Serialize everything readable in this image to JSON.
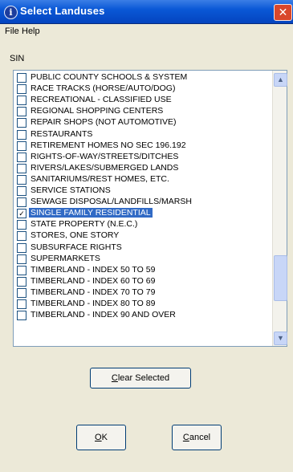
{
  "window": {
    "title": "Select Landuses",
    "close_glyph": "✕",
    "title_icon_glyph": "i"
  },
  "menu": [
    {
      "label": "File"
    },
    {
      "label": "Help"
    }
  ],
  "section_label": "SIN",
  "list": {
    "items": [
      {
        "label": "PUBLIC COUNTY SCHOOLS & SYSTEM",
        "checked": false,
        "selected": false
      },
      {
        "label": "RACE TRACKS (HORSE/AUTO/DOG)",
        "checked": false,
        "selected": false
      },
      {
        "label": "RECREATIONAL - CLASSIFIED USE",
        "checked": false,
        "selected": false
      },
      {
        "label": "REGIONAL SHOPPING CENTERS",
        "checked": false,
        "selected": false
      },
      {
        "label": "REPAIR SHOPS (NOT AUTOMOTIVE)",
        "checked": false,
        "selected": false
      },
      {
        "label": "RESTAURANTS",
        "checked": false,
        "selected": false
      },
      {
        "label": "RETIREMENT HOMES NO SEC 196.192",
        "checked": false,
        "selected": false
      },
      {
        "label": "RIGHTS-OF-WAY/STREETS/DITCHES",
        "checked": false,
        "selected": false
      },
      {
        "label": "RIVERS/LAKES/SUBMERGED LANDS",
        "checked": false,
        "selected": false
      },
      {
        "label": "SANITARIUMS/REST HOMES, ETC.",
        "checked": false,
        "selected": false
      },
      {
        "label": "SERVICE STATIONS",
        "checked": false,
        "selected": false
      },
      {
        "label": "SEWAGE DISPOSAL/LANDFILLS/MARSH",
        "checked": false,
        "selected": false
      },
      {
        "label": "SINGLE FAMILY RESIDENTIAL",
        "checked": true,
        "selected": true
      },
      {
        "label": "STATE PROPERTY (N.E.C.)",
        "checked": false,
        "selected": false
      },
      {
        "label": "STORES, ONE STORY",
        "checked": false,
        "selected": false
      },
      {
        "label": "SUBSURFACE RIGHTS",
        "checked": false,
        "selected": false
      },
      {
        "label": "SUPERMARKETS",
        "checked": false,
        "selected": false
      },
      {
        "label": "TIMBERLAND - INDEX 50 TO 59",
        "checked": false,
        "selected": false
      },
      {
        "label": "TIMBERLAND - INDEX 60 TO 69",
        "checked": false,
        "selected": false
      },
      {
        "label": "TIMBERLAND - INDEX 70 TO 79",
        "checked": false,
        "selected": false
      },
      {
        "label": "TIMBERLAND - INDEX 80 TO 89",
        "checked": false,
        "selected": false
      },
      {
        "label": "TIMBERLAND - INDEX 90 AND OVER",
        "checked": false,
        "selected": false
      }
    ],
    "check_glyph": "✓",
    "scroll_up_glyph": "▲",
    "scroll_down_glyph": "▼",
    "selection_color": "#316ac5"
  },
  "buttons": {
    "clear_selected": {
      "pre": "",
      "mnemonic": "C",
      "post": "lear Selected"
    },
    "ok": {
      "pre": "",
      "mnemonic": "O",
      "post": "K"
    },
    "cancel": {
      "pre": "",
      "mnemonic": "C",
      "post": "ancel"
    }
  },
  "colors": {
    "titlebar": "#0a58d6",
    "dialog_bg": "#ece9d8",
    "close_button": "#d9472b"
  }
}
